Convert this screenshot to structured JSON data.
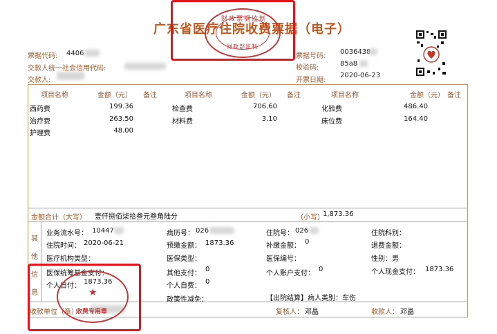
{
  "title": "广东省医疗住院收费票据（电子）",
  "header": {
    "bill_code_label": "票据代码:",
    "bill_code_value": "4406",
    "payer_credit_label": "交款人统一社会信用代码:",
    "payer_label": "交款人:",
    "bill_no_label": "票据号码:",
    "bill_no_value": "0036438",
    "check_code_label": "校验码:",
    "check_code_value": "85a8",
    "issue_date_label": "开票日期:",
    "issue_date_value": "2020-06-23"
  },
  "stamp_top": {
    "outer_text": "财政票据监制",
    "inner_text": "财政部监制"
  },
  "columns": {
    "item_name": "项目名称",
    "amount": "金额（元）",
    "note": "备注"
  },
  "items": [
    {
      "name": "西药费",
      "amount": "199.36"
    },
    {
      "name": "治疗费",
      "amount": "263.50"
    },
    {
      "name": "护理费",
      "amount": "48.00"
    },
    {
      "name": "检查费",
      "amount": "706.60"
    },
    {
      "name": "材料费",
      "amount": "3.10"
    },
    {
      "name": "化验费",
      "amount": "486.40"
    },
    {
      "name": "床位费",
      "amount": "164.40"
    }
  ],
  "total": {
    "label": "金额合计（大写）",
    "uppercase": "壹仟捌佰柒拾叁元叁角陆分",
    "small_label": "（小写）",
    "value": "1,873.36"
  },
  "other_info": {
    "side_label": [
      "其",
      "他",
      "信",
      "息"
    ],
    "serial_label": "业务流水号：",
    "serial_value": "10447",
    "case_no_label": "病历号：",
    "case_no_value": "026",
    "inpatient_no_label": "住院号：",
    "inpatient_no_value": "026",
    "dept_label": "住院科别：",
    "admit_time_label": "住院时间：",
    "admit_time_value": "2020-06-21",
    "prepay_label": "预缴金额：",
    "prepay_value": "1873.36",
    "supplement_label": "补缴金额：",
    "supplement_value": "0",
    "refund_label": "退费金额：",
    "institution_type_label": "医疗机构类型：",
    "insurance_type_label": "医保类型：",
    "insurance_no_label": "医保编号：",
    "gender_label": "性别：",
    "gender_value": "男",
    "fund_pay_label": "医保统筹基金支付：",
    "other_pay_label": "其他支付：",
    "other_pay_value": "0",
    "account_pay_label": "个人账户支付：",
    "account_pay_value": "0",
    "cash_pay_label": "个人现金支付：",
    "cash_pay_value": "1873.36",
    "self_pay_label": "个人自付：",
    "self_pay_value": "1873.36",
    "self_expense_label": "个人自费：",
    "self_expense_value": "0",
    "policy_label": "政策性减免：",
    "discharge_label": "【出院结算】病人类别：车伤"
  },
  "footer": {
    "payee_unit_label": "收款单位（章）：",
    "reviewer_label": "复核人：",
    "reviewer_value": "邓晶",
    "payee_label": "收款人：",
    "payee_value": "邓晶"
  },
  "stamp_bottom": {
    "inner_text": "收费专用章"
  },
  "colors": {
    "title": "#c4561d",
    "labels": "#9e5a2d",
    "border": "#c8906a",
    "seal": "#c03a3a",
    "highlight_box": "#e1151b"
  }
}
